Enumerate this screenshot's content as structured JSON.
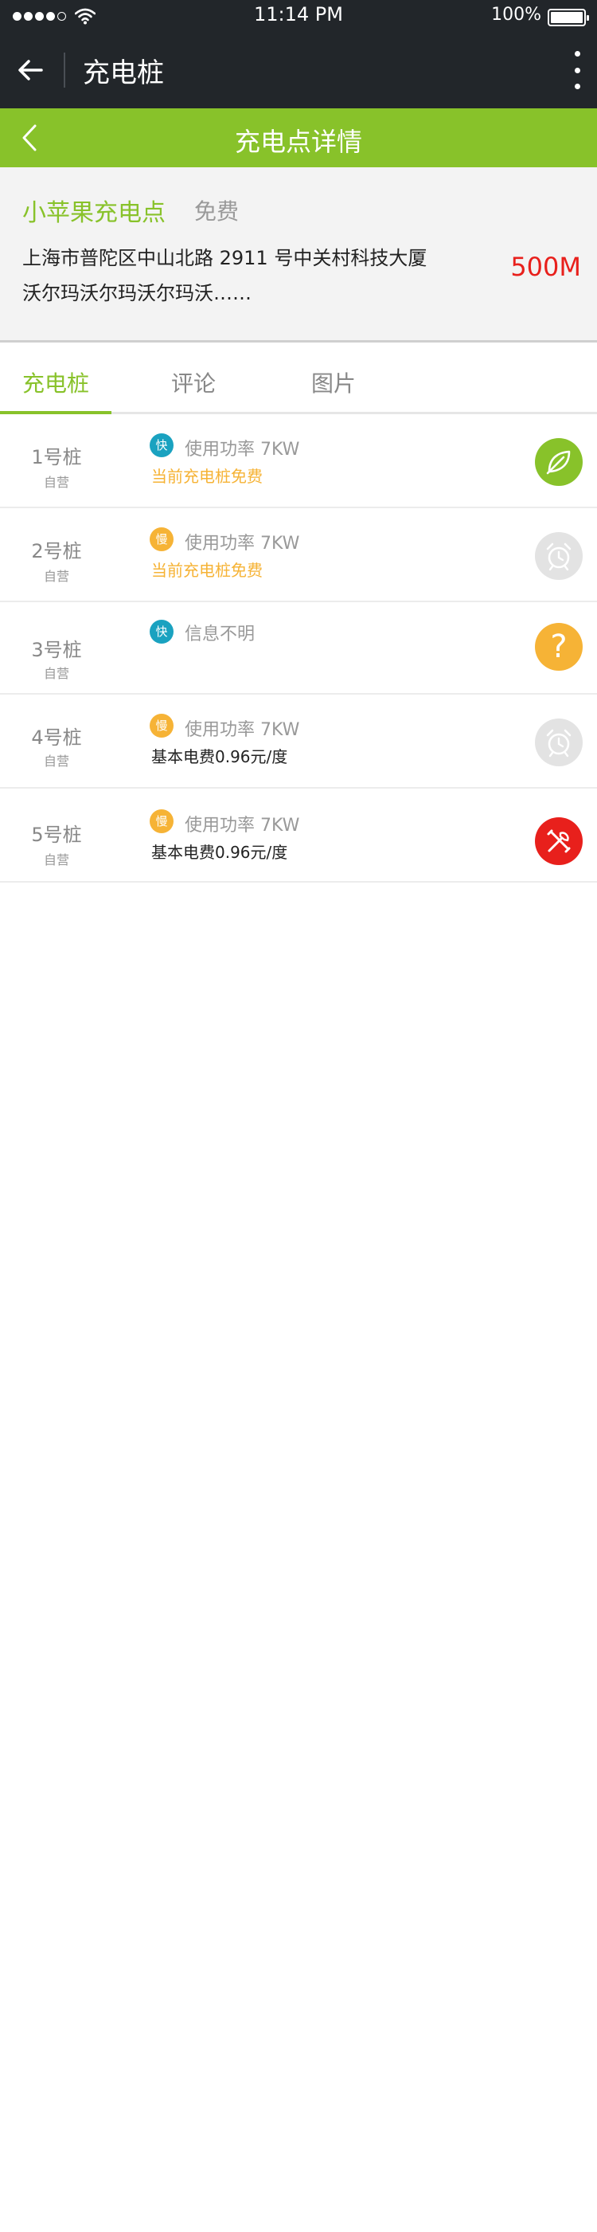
{
  "status_bar": {
    "time": "11:14 PM",
    "battery": "100%"
  },
  "app_bar": {
    "title": "充电桩"
  },
  "header": {
    "title": "充电点详情"
  },
  "station": {
    "name": "小苹果充电点",
    "fee": "免费",
    "address": "上海市普陀区中山北路 2911 号中关村科技大厦沃尔玛沃尔玛沃尔玛沃……",
    "distance": "500M"
  },
  "tabs": [
    {
      "label": "充电桩",
      "active": true
    },
    {
      "label": "评论",
      "active": false
    },
    {
      "label": "图片",
      "active": false
    }
  ],
  "piles": [
    {
      "name": "1号桩",
      "owner": "自营",
      "speed": "快",
      "info": "使用功率 7KW",
      "sub": "当前充电桩免费",
      "status": "leaf-icon"
    },
    {
      "name": "2号桩",
      "owner": "自营",
      "speed": "慢",
      "info": "使用功率 7KW",
      "sub": "当前充电桩免费",
      "status": "alarm-clock-icon"
    },
    {
      "name": "3号桩",
      "owner": "自营",
      "speed": "快",
      "info": "信息不明",
      "sub": "",
      "status": "question-icon",
      "status_text": "?"
    },
    {
      "name": "4号桩",
      "owner": "自营",
      "speed": "慢",
      "info": "使用功率 7KW",
      "sub": "基本电费0.96元/度",
      "status": "alarm-clock-icon"
    },
    {
      "name": "5号桩",
      "owner": "自营",
      "speed": "慢",
      "info": "使用功率 7KW",
      "sub": "基本电费0.96元/度",
      "status": "repair-tools-icon"
    }
  ],
  "colors": {
    "accent": "#88c22a",
    "dark_bar": "#22262a",
    "fast": "#1aa2c0",
    "slow": "#f6b336",
    "distance": "#e8201c"
  }
}
